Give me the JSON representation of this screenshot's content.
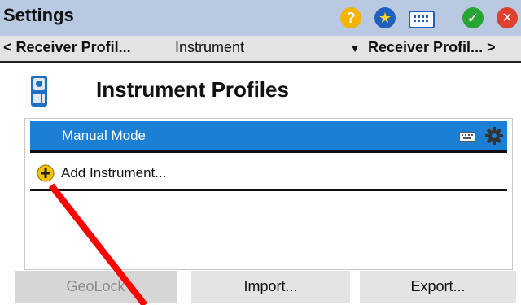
{
  "window": {
    "title": "Settings"
  },
  "toolbar_icons": [
    {
      "name": "help-icon",
      "glyph": "?",
      "color": "#f2b400"
    },
    {
      "name": "favorites-star-icon",
      "glyph": "★",
      "color": "#1f5fbf"
    },
    {
      "name": "keyboard-icon",
      "glyph": "",
      "color": "#1f5fbf"
    },
    {
      "name": "accept-check-icon",
      "glyph": "✓",
      "color": "#27a532"
    },
    {
      "name": "close-icon",
      "glyph": "✕",
      "color": "#e0402f"
    }
  ],
  "nav": {
    "prev_label": "< Receiver Profil...",
    "current_value": "Instrument",
    "next_label": "Receiver Profil... >"
  },
  "page": {
    "title": "Instrument Profiles"
  },
  "list": {
    "items": [
      {
        "label": "Manual Mode",
        "selected": true
      }
    ],
    "add_label": "Add Instrument..."
  },
  "actions": {
    "geolock_label": "GeoLock",
    "import_label": "Import...",
    "export_label": "Export..."
  },
  "colors": {
    "titlebar_bg": "#b9c9e2",
    "selection": "#1b7fd6",
    "annotation_arrow": "#ff0000"
  }
}
